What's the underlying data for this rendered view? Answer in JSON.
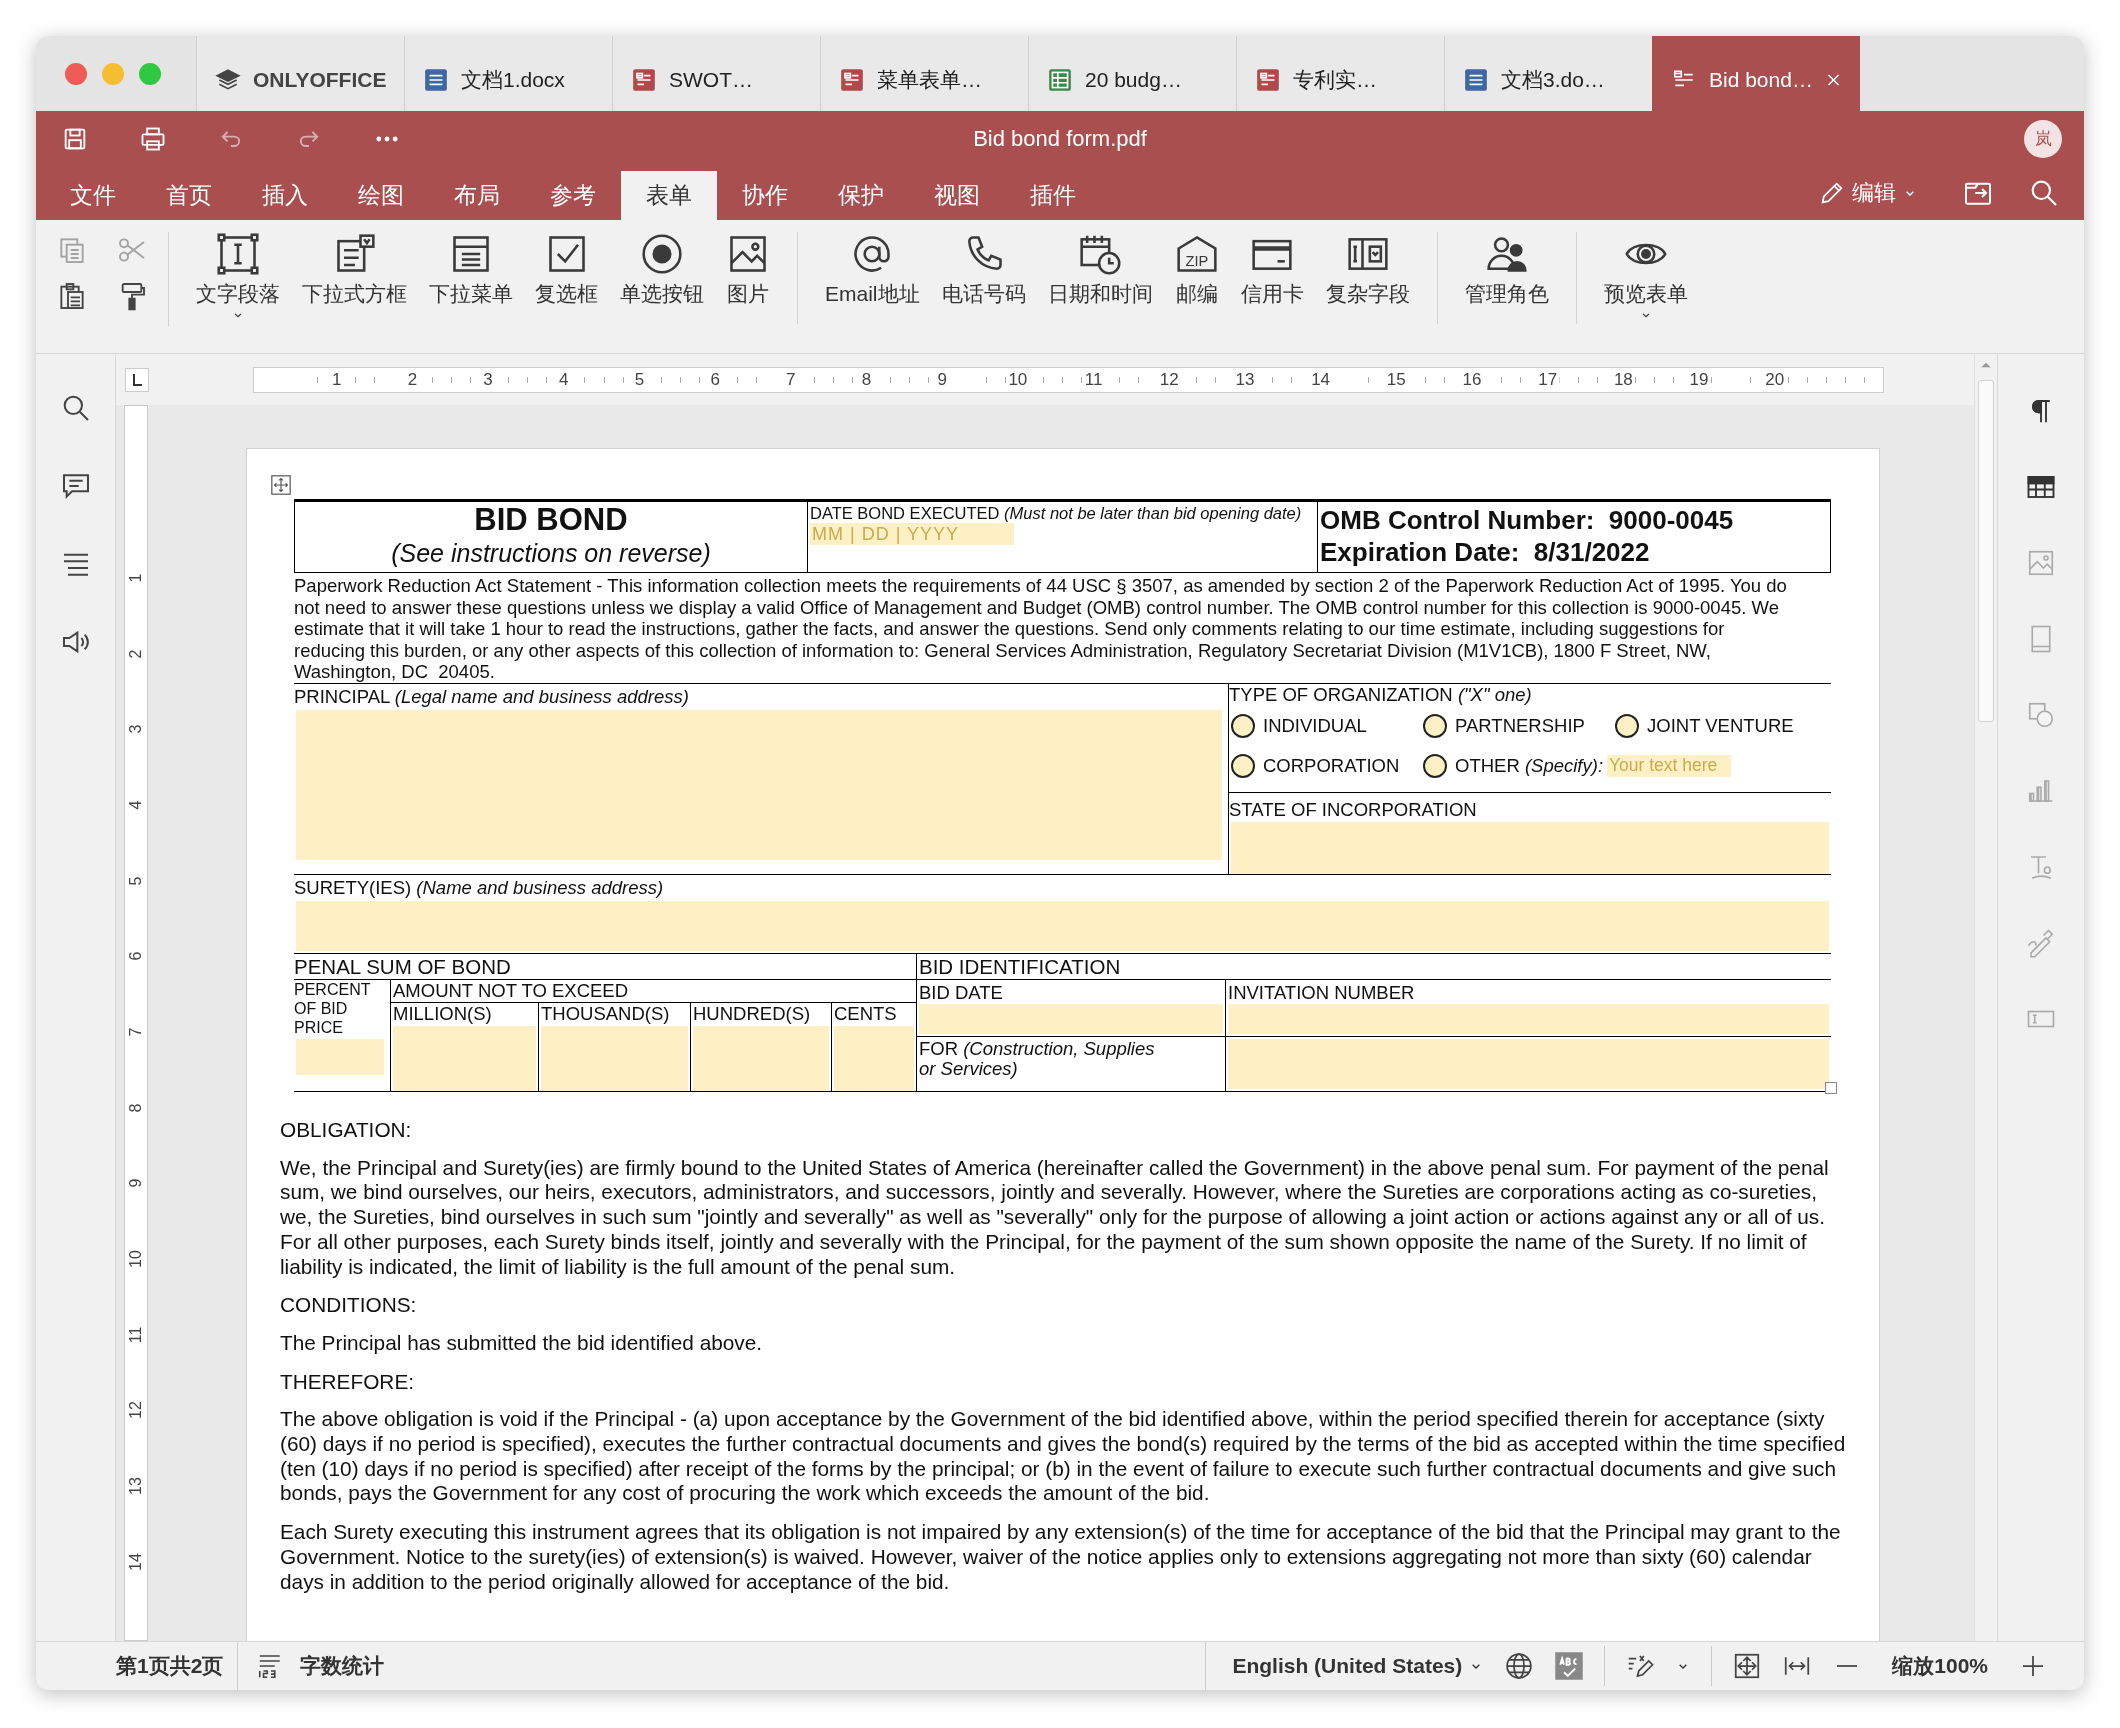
{
  "window_tabs": [
    {
      "label": "ONLYOFFICE",
      "kind": "home",
      "selected": false
    },
    {
      "label": "文档1.docx",
      "kind": "doc",
      "selected": false
    },
    {
      "label": "SWOT…",
      "kind": "pdf",
      "selected": false
    },
    {
      "label": "菜单表单…",
      "kind": "pdf",
      "selected": false
    },
    {
      "label": "20 budg…",
      "kind": "sheet",
      "selected": false
    },
    {
      "label": "专利实…",
      "kind": "pdf",
      "selected": false
    },
    {
      "label": "文档3.do…",
      "kind": "doc",
      "selected": false
    },
    {
      "label": "Bid bond…",
      "kind": "pdf",
      "selected": true
    }
  ],
  "title": "Bid bond form.pdf",
  "user_initial": "岚",
  "menu": [
    {
      "label": "文件",
      "selected": false
    },
    {
      "label": "首页",
      "selected": false
    },
    {
      "label": "插入",
      "selected": false
    },
    {
      "label": "绘图",
      "selected": false
    },
    {
      "label": "布局",
      "selected": false
    },
    {
      "label": "参考",
      "selected": false
    },
    {
      "label": "表单",
      "selected": true
    },
    {
      "label": "协作",
      "selected": false
    },
    {
      "label": "保护",
      "selected": false
    },
    {
      "label": "视图",
      "selected": false
    },
    {
      "label": "插件",
      "selected": false
    }
  ],
  "edit_mode": "编辑",
  "toolbar_groups": [
    [
      {
        "label": "文字段落",
        "kind": "textfield",
        "caret": true
      },
      {
        "label": "下拉式方框",
        "kind": "combo",
        "caret": false
      },
      {
        "label": "下拉菜单",
        "kind": "dropdown",
        "caret": false
      },
      {
        "label": "复选框",
        "kind": "checkbox",
        "caret": false
      },
      {
        "label": "单选按钮",
        "kind": "radio",
        "caret": false
      },
      {
        "label": "图片",
        "kind": "image",
        "caret": false
      }
    ],
    [
      {
        "label": "Email地址",
        "kind": "at",
        "caret": false
      },
      {
        "label": "电话号码",
        "kind": "phone",
        "caret": false
      },
      {
        "label": "日期和时间",
        "kind": "calendar",
        "caret": false
      },
      {
        "label": "邮编",
        "kind": "zip",
        "icon_text": "ZIP",
        "caret": false
      },
      {
        "label": "信用卡",
        "kind": "card",
        "caret": false
      },
      {
        "label": "复杂字段",
        "kind": "complex",
        "caret": false
      }
    ],
    [
      {
        "label": "管理角色",
        "kind": "roles",
        "caret": false
      }
    ],
    [
      {
        "label": "预览表单",
        "kind": "eye",
        "caret": true
      }
    ]
  ],
  "ruler_numbers": [
    "1",
    "2",
    "3",
    "4",
    "5",
    "6",
    "7",
    "8",
    "9",
    "10",
    "11",
    "12",
    "13",
    "14",
    "15",
    "16",
    "17",
    "18",
    "19",
    "20"
  ],
  "vertical_ruler_numbers": [
    "1",
    "2",
    "3",
    "4",
    "5",
    "6",
    "7",
    "8",
    "9",
    "10",
    "11",
    "12",
    "13",
    "14"
  ],
  "form": {
    "title": "BID BOND",
    "subtitle": "(See instructions on reverse)",
    "date_label": "DATE BOND EXECUTED *(Must not be later than bid opening date)*",
    "date_placeholder": "MM | DD | YYYY",
    "omb": "OMB Control Number:  9000-0045",
    "expiration": "Expiration Date:  8/31/2022",
    "paperwork": "Paperwork Reduction Act Statement - This information collection meets the requirements of 44 USC § 3507, as amended by section 2 of the Paperwork Reduction Act of 1995. You do not need to answer these questions unless we display a valid Office of Management and Budget (OMB) control number. The OMB control number for this collection is 9000-0045. We estimate that it will take 1 hour to read the instructions, gather the facts, and answer the questions. Send only comments relating to our time estimate, including suggestions for reducing this burden, or any other aspects of this collection of information to: General Services Administration, Regulatory Secretariat Division (M1V1CB), 1800 F Street, NW, Washington, DC  20405.",
    "principal_label": "PRINCIPAL *(Legal name and business address)*",
    "org_label": "TYPE OF ORGANIZATION *(\"X\" one)*",
    "org_options": [
      {
        "label": "INDIVIDUAL",
        "kind": "plain",
        "selected": false
      },
      {
        "label": "PARTNERSHIP",
        "kind": "plain",
        "selected": false
      },
      {
        "label": "JOINT VENTURE",
        "kind": "plain",
        "selected": false
      },
      {
        "label": "CORPORATION",
        "kind": "plain",
        "selected": false
      },
      {
        "label": "OTHER *(Specify):*",
        "kind": "other",
        "placeholder": "Your text here",
        "selected": false
      }
    ],
    "state_label": "STATE OF INCORPORATION",
    "surety_label": "SURETY(IES) *(Name and business address)*",
    "penal_title": "PENAL SUM OF BOND",
    "percent_label": "PERCENT OF BID PRICE",
    "amount_label": "AMOUNT NOT TO EXCEED",
    "amount_columns": [
      "MILLION(S)",
      "THOUSAND(S)",
      "HUNDRED(S)",
      "CENTS"
    ],
    "bid_title": "BID IDENTIFICATION",
    "bid_date_label": "BID DATE",
    "invitation_label": "INVITATION NUMBER",
    "for_label": "FOR *(Construction, Supplies or Services)*"
  },
  "body": [
    {
      "kind": "heading",
      "text": "OBLIGATION:"
    },
    {
      "kind": "paragraph",
      "text": "We, the Principal and Surety(ies) are firmly bound to the United States of America (hereinafter called the Government) in the above penal sum. For payment of the penal sum, we bind ourselves, our heirs, executors, administrators, and successors, jointly and severally. However, where the Sureties are corporations acting as co-sureties, we, the Sureties, bind ourselves in such sum \"jointly and severally\" as well as \"severally\" only for the purpose of allowing a joint action or actions against any or all of us. For all other purposes, each Surety binds itself, jointly and severally with the Principal, for the payment of the sum shown opposite the name of the Surety. If no limit of liability is indicated, the limit of liability is the full amount of the penal sum."
    },
    {
      "kind": "heading",
      "text": "CONDITIONS:"
    },
    {
      "kind": "paragraph",
      "text": "The Principal has submitted the bid identified above."
    },
    {
      "kind": "heading",
      "text": "THEREFORE:"
    },
    {
      "kind": "paragraph",
      "text": "The above obligation is void if the Principal - (a) upon acceptance by the Government of the bid identified above, within the period specified therein for acceptance (sixty (60) days if no period is specified), executes the further contractual documents and gives the bond(s) required by the terms of the bid as accepted within the time specified (ten (10) days if no period is specified) after receipt of the forms by the principal; or (b) in the event of failure to execute such further contractual documents and give such bonds, pays the Government for any cost of procuring the work which exceeds the amount of the bid."
    },
    {
      "kind": "paragraph",
      "text": "Each Surety executing this instrument agrees that its obligation is not impaired by any extension(s) of the time for acceptance of the bid that the Principal may grant to the Government. Notice to the surety(ies) of extension(s) is waived. However, waiver of the notice applies only to extensions aggregating not more than sixty (60) calendar days in addition to the period originally allowed for acceptance of the bid."
    }
  ],
  "status_bar": {
    "page_info": "第1页共2页",
    "word_count": "字数统计",
    "language": "English (United States)",
    "zoom": "缩放100%"
  }
}
